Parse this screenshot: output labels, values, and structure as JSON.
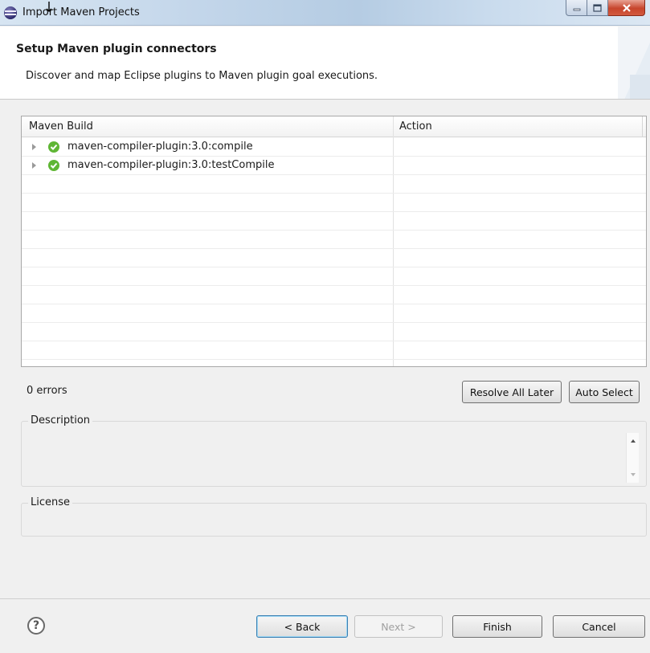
{
  "window": {
    "title": "Import Maven Projects"
  },
  "banner": {
    "title": "Setup Maven plugin connectors",
    "description": "Discover and map Eclipse plugins to Maven plugin goal executions."
  },
  "table": {
    "columns": [
      "Maven Build",
      "Action"
    ],
    "rows": [
      {
        "label": "maven-compiler-plugin:3.0:compile",
        "action": "",
        "status_icon": "check-circle-icon"
      },
      {
        "label": "maven-compiler-plugin:3.0:testCompile",
        "action": "",
        "status_icon": "check-circle-icon"
      }
    ]
  },
  "status": {
    "errors": "0 errors"
  },
  "actions": {
    "resolve_all_later": "Resolve All Later",
    "auto_select": "Auto Select"
  },
  "groups": {
    "description_label": "Description",
    "license_label": "License"
  },
  "footer": {
    "help_icon": "?",
    "back": "< Back",
    "next": "Next >",
    "finish": "Finish",
    "cancel": "Cancel"
  },
  "colors": {
    "check": "#5fb634",
    "default_button_border": "#3c7fb1",
    "close_button": "#c7452c"
  }
}
